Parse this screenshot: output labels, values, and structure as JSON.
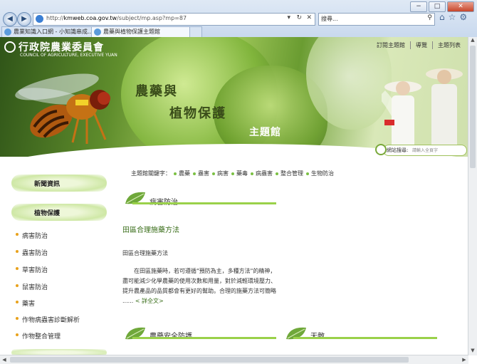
{
  "browser": {
    "url_prefix": "http://",
    "url_domain": "kmweb.coa.gov.tw",
    "url_path": "/subject/mp.asp?mp=87",
    "search_placeholder": "搜尋...",
    "tabs": [
      {
        "label": "農業知識入口網 - 小知識串成..."
      },
      {
        "label": "農藥與植物保護主題館"
      }
    ],
    "window_controls": {
      "minimize": "−",
      "maximize": "□",
      "close": "✕"
    }
  },
  "header": {
    "logo_zh": "行政院農業委員會",
    "logo_en": "COUNCIL OF AGRICULTURE, EXECUTIVE YUAN",
    "topnav": [
      "訂閱主題館",
      "導覽",
      "主題列表"
    ],
    "title_line1": "農藥與",
    "title_line2": "植物保護",
    "title_line3": "主題館",
    "site_search_label": "網站搜尋:",
    "site_search_placeholder": "請輸入全頁字"
  },
  "sidebar": {
    "news_heading": "新聞資訊",
    "plant_heading": "植物保護",
    "items": [
      {
        "label": "病害防治"
      },
      {
        "label": "蟲害防治"
      },
      {
        "label": "草害防治"
      },
      {
        "label": "鼠害防治"
      },
      {
        "label": "藥害"
      },
      {
        "label": "作物病蟲害診斷解析"
      },
      {
        "label": "作物整合管理"
      }
    ]
  },
  "keywords": {
    "label": "主題館關鍵字：",
    "items": [
      "農藥",
      "蟲害",
      "病害",
      "藥毒",
      "病蟲害",
      "整合管理",
      "生物防治"
    ]
  },
  "main": {
    "section1_title": "病害防治",
    "article_title": "田區合理施藥方法",
    "article_subtitle": "田區合理施藥方法",
    "article_text": "在田區施藥時，若可遵循\"預防為主，多種方法\"的精神，盡可能減少化學農藥的使用次數和用量，對於減輕環境壓力、提升農產品的品質都會有更好的幫助。合理的施藥方法可簡略 ...... ",
    "more_label": "< 詳全文>",
    "section2_title": "農藥安全防護",
    "section3_title": "天敵"
  },
  "colors": {
    "accent_green": "#9ad14a",
    "bullet_orange": "#e9a21c",
    "link_green": "#3a6e1a"
  }
}
